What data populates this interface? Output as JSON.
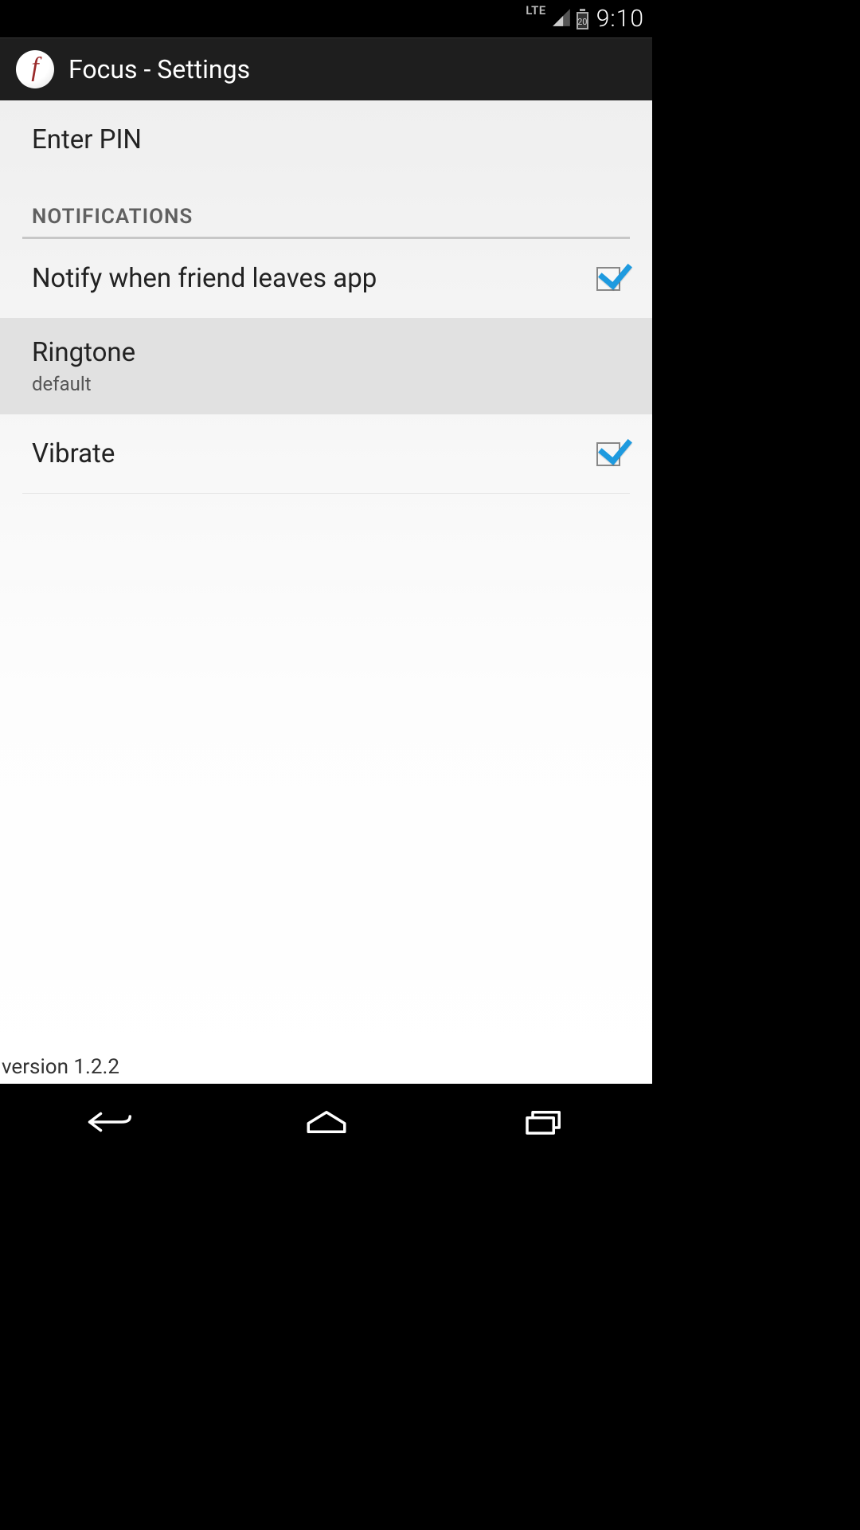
{
  "status": {
    "network_type": "LTE",
    "battery_percent": "20",
    "time": "9:10"
  },
  "header": {
    "app_icon_letter": "f",
    "title": "Focus - Settings"
  },
  "settings": {
    "enter_pin_label": "Enter PIN",
    "section_notifications": "NOTIFICATIONS",
    "notify_friend_leaves_label": "Notify when friend leaves app",
    "notify_friend_leaves_checked": true,
    "ringtone_label": "Ringtone",
    "ringtone_value": "default",
    "vibrate_label": "Vibrate",
    "vibrate_checked": true
  },
  "footer": {
    "version_text": "version 1.2.2"
  }
}
